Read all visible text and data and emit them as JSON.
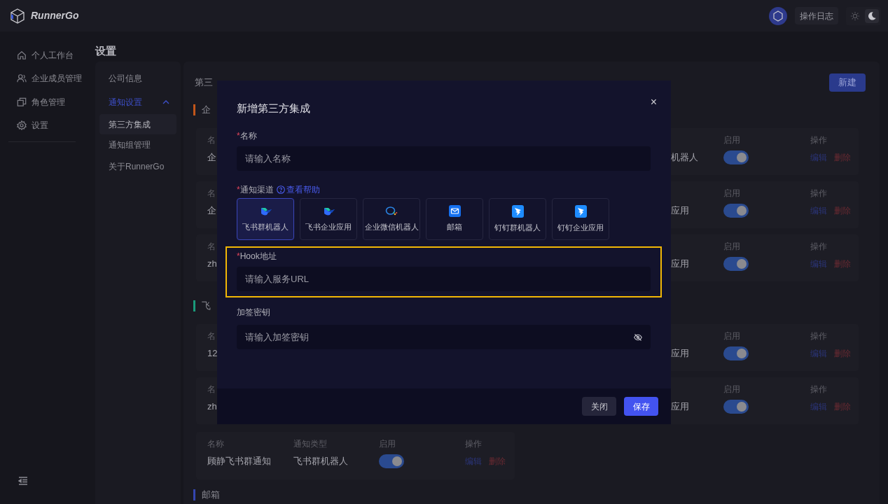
{
  "header": {
    "logo_text": "RunnerGo",
    "log_button": "操作日志",
    "theme_options": [
      {
        "kind": "sun",
        "selected": false
      },
      {
        "kind": "moon",
        "selected": true
      }
    ]
  },
  "sidebar": {
    "items": [
      {
        "kind": "home",
        "label": "个人工作台"
      },
      {
        "kind": "users",
        "label": "企业成员管理"
      },
      {
        "kind": "roles",
        "label": "角色管理"
      },
      {
        "kind": "gear",
        "label": "设置"
      }
    ]
  },
  "page_title": "设置",
  "settings_nav": {
    "items": [
      {
        "label": "公司信息",
        "expanded": false
      },
      {
        "label": "通知设置",
        "expanded": true,
        "children": [
          {
            "label": "第三方集成",
            "selected": true
          },
          {
            "label": "通知组管理",
            "selected": false
          }
        ]
      },
      {
        "label": "关于RunnerGo",
        "expanded": false
      }
    ]
  },
  "main": {
    "title": "第三",
    "new_button": "新建",
    "sections": [
      {
        "heading": "企",
        "color": "#c2561a",
        "rows": [
          {
            "kind": "split",
            "name_label": "名",
            "name": "企",
            "type": "机器人",
            "enabled_label": "启用",
            "on": true,
            "actions_label": "操作",
            "edit": "编辑",
            "delete": "删除"
          },
          {
            "kind": "split",
            "name_label": "名",
            "name": "企",
            "type": "应用",
            "enabled_label": "启用",
            "on": true,
            "actions_label": "操作",
            "edit": "编辑",
            "delete": "删除"
          },
          {
            "kind": "split",
            "name_label": "名",
            "name": "zh",
            "type": "应用",
            "enabled_label": "启用",
            "on": true,
            "actions_label": "操作",
            "edit": "编辑",
            "delete": "删除"
          }
        ]
      },
      {
        "heading": "飞",
        "color": "#1a9a7a",
        "rows": [
          {
            "kind": "split",
            "name_label": "名",
            "name": "12",
            "type": "应用",
            "enabled_label": "启用",
            "on": true,
            "actions_label": "操作",
            "edit": "编辑",
            "delete": "删除"
          },
          {
            "kind": "split",
            "name_label": "名",
            "name": "zh",
            "type": "应用",
            "enabled_label": "启用",
            "on": true,
            "actions_label": "操作",
            "edit": "编辑",
            "delete": "删除"
          },
          {
            "kind": "full",
            "name_label": "名称",
            "name": "顾静飞书群通知",
            "type_label": "通知类型",
            "type": "飞书群机器人",
            "enabled_label": "启用",
            "on": true,
            "actions_label": "操作",
            "edit": "编辑",
            "delete": "删除"
          }
        ]
      },
      {
        "heading": "邮箱",
        "color": "#3445b0"
      }
    ]
  },
  "modal": {
    "title": "新增第三方集成",
    "close": "×",
    "fields": [
      {
        "kind": "text",
        "required_mark": "*",
        "label": "名称",
        "placeholder": "请输入名称"
      },
      {
        "kind": "channels",
        "required_mark": "*",
        "label": "通知渠道",
        "help": "查看帮助",
        "options": [
          {
            "kind": "feishu",
            "label": "飞书群机器人",
            "selected": true
          },
          {
            "kind": "feishu",
            "label": "飞书企业应用",
            "selected": false
          },
          {
            "kind": "wecom",
            "label": "企业微信机器人",
            "selected": false
          },
          {
            "kind": "mail",
            "label": "邮箱",
            "selected": false
          },
          {
            "kind": "dingtalk",
            "label": "钉钉群机器人",
            "selected": false
          },
          {
            "kind": "dingtalk",
            "label": "钉钉企业应用",
            "selected": false
          }
        ]
      },
      {
        "kind": "text",
        "required_mark": "*",
        "label": "Hook地址",
        "placeholder": "请输入服务URL",
        "highlighted": true
      },
      {
        "kind": "password",
        "label": "加签密钥",
        "placeholder": "请输入加签密钥"
      }
    ],
    "buttons": [
      {
        "kind": "secondary",
        "label": "关闭"
      },
      {
        "kind": "primary",
        "label": "保存"
      }
    ]
  }
}
